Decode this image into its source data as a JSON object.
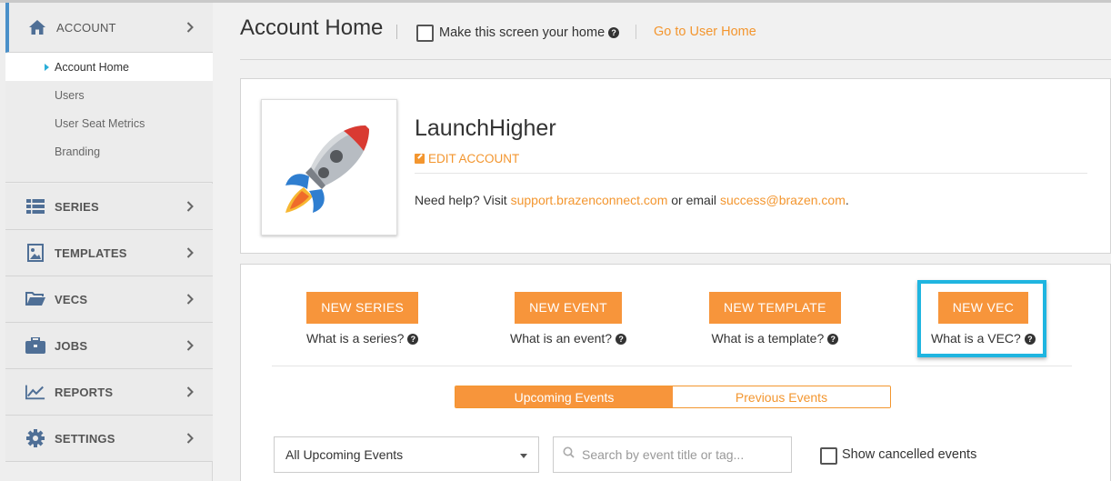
{
  "sidebar": {
    "account": {
      "label": "ACCOUNT",
      "icon": "home-icon"
    },
    "sub_items": [
      {
        "label": "Account Home",
        "active": true
      },
      {
        "label": "Users"
      },
      {
        "label": "User Seat Metrics"
      },
      {
        "label": "Branding"
      }
    ],
    "sections": [
      {
        "label": "SERIES",
        "icon": "list-icon"
      },
      {
        "label": "TEMPLATES",
        "icon": "image-icon"
      },
      {
        "label": "VECS",
        "icon": "folder-icon"
      },
      {
        "label": "JOBS",
        "icon": "briefcase-icon"
      },
      {
        "label": "REPORTS",
        "icon": "chart-line-icon"
      },
      {
        "label": "SETTINGS",
        "icon": "gear-icon"
      }
    ]
  },
  "header": {
    "title": "Account Home",
    "home_checkbox_label": "Make this screen your home",
    "home_checkbox_checked": false,
    "user_home_link": "Go to User Home"
  },
  "account": {
    "name": "LaunchHigher",
    "edit_label": "EDIT ACCOUNT",
    "help_prefix": "Need help? Visit ",
    "support_link": "support.brazenconnect.com",
    "help_middle": " or email ",
    "email_link": "success@brazen.com",
    "help_suffix": "."
  },
  "actions": [
    {
      "button": "NEW SERIES",
      "what": "What is a series?"
    },
    {
      "button": "NEW EVENT",
      "what": "What is an event?"
    },
    {
      "button": "NEW TEMPLATE",
      "what": "What is a template?"
    },
    {
      "button": "NEW VEC",
      "what": "What is a VEC?"
    }
  ],
  "tabs": {
    "upcoming": "Upcoming Events",
    "previous": "Previous Events",
    "active": "upcoming"
  },
  "filters": {
    "event_select_value": "All Upcoming Events",
    "search_placeholder": "Search by event title or tag...",
    "show_cancelled_label": "Show cancelled events",
    "show_cancelled_checked": false
  },
  "colors": {
    "accent": "#f7953b",
    "link": "#f3962f",
    "highlight": "#1fb5e0",
    "sidebar_active_bar": "#4a90c9"
  }
}
